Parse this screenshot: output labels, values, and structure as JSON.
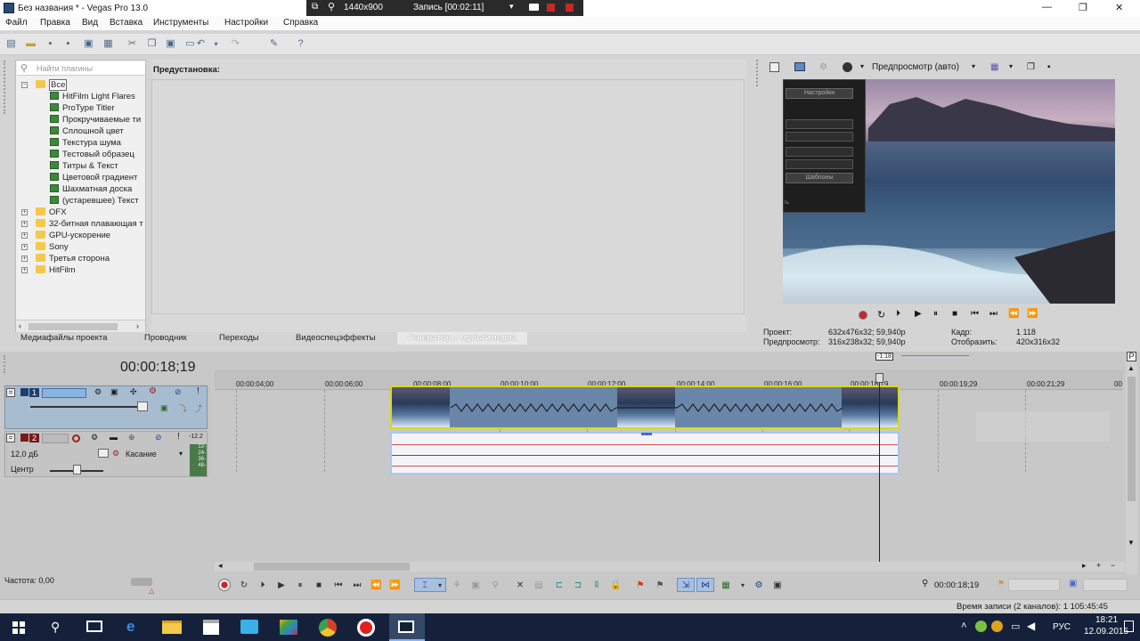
{
  "window": {
    "title": "Без названия * - Vegas Pro 13.0",
    "minimize": "—",
    "maximize": "❐",
    "close": "✕"
  },
  "recorder": {
    "resolution": "1440x900",
    "status": "Запись [00:02:11]"
  },
  "menu": [
    "Файл",
    "Правка",
    "Вид",
    "Вставка",
    "Инструменты",
    "Настройки",
    "Справка"
  ],
  "plugins": {
    "search_placeholder": "Найти плагины",
    "root": "Все",
    "items": [
      "HitFilm Light Flares",
      "ProType Titler",
      "Прокручиваемые ти",
      "Сплошной цвет",
      "Текстура шума",
      "Тестовый образец",
      "Титры & Текст",
      "Цветовой градиент",
      "Шахматная доска",
      "(устаревшее) Текст"
    ],
    "folders": [
      "OFX",
      "32-битная плавающая т",
      "GPU-ускорение",
      "Sony",
      "Третья сторона",
      "HitFilm"
    ]
  },
  "preset": {
    "label": "Предустановка:"
  },
  "tabs": [
    "Медиафайлы проекта",
    "Проводник",
    "Переходы",
    "Видеоспецэффекты",
    "Генераторы мультимедиа"
  ],
  "preview": {
    "mode": "Предпросмотр (авто)",
    "overlay_btn1": "Настройки",
    "overlay_btn2": "Шаблоны",
    "overlay_text": "ть",
    "info": {
      "project_label": "Проект:",
      "project_value": "632x476x32; 59,940p",
      "preview_label": "Предпросмотр:",
      "preview_value": "316x238x32; 59,940p",
      "frame_label": "Кадр:",
      "frame_value": "1 118",
      "display_label": "Отобразить:",
      "display_value": "420x316x32"
    }
  },
  "timeline": {
    "timecode": "00:00:18;19",
    "ticks": [
      "00:00:04;00",
      "00:00:06;00",
      "00:00:08;00",
      "00:00:10;00",
      "00:00:12;00",
      "00:00:14;00",
      "00:00:16;00",
      "00:00:18;19",
      "00:00:19;29",
      "00:00:21;29",
      "00"
    ],
    "cursor_marker": "-1:18",
    "track1_num": "1",
    "track2_num": "2",
    "volume": "12,0 дБ",
    "pan_label": "Центр",
    "automation": "Касание",
    "meter_labels": [
      "-12.2",
      "12-",
      "24-",
      "36-",
      "48-"
    ],
    "rate_label": "Частота: 0,00",
    "bottom_timecode": "00:00:18;19"
  },
  "status": {
    "record_time": "Время записи (2 каналов): 1 105:45:45"
  },
  "taskbar": {
    "lang": "РУС",
    "time": "18:21",
    "date": "12.09.2015"
  }
}
